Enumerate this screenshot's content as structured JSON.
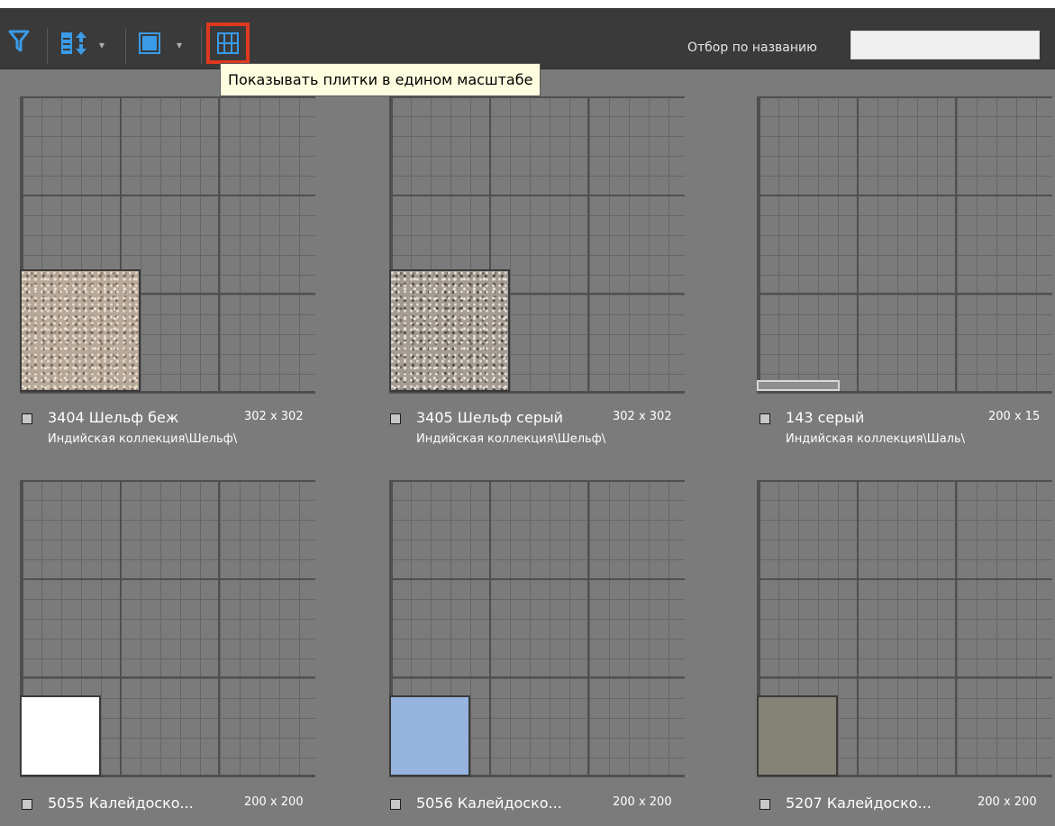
{
  "toolbar": {
    "icons": [
      "filter-icon",
      "sort-icon",
      "chevron-down-icon",
      "view-mode-icon",
      "chevron-down-icon",
      "uniform-scale-icon"
    ],
    "dropdown_glyph": "▾",
    "search": {
      "label": "Отбор по названию",
      "value": "",
      "placeholder": ""
    },
    "tooltip": "Показывать плитки в едином масштабе",
    "highlight_color": "#e0381f",
    "icon_color": "#3a9be8"
  },
  "tiles": [
    {
      "name": "3404 Шельф беж",
      "size": "302 x 302",
      "path": "Индийская коллекция\\Шельф\\",
      "color": "#b8a897",
      "texture": "speckle-beige"
    },
    {
      "name": "3405 Шельф серый",
      "size": "302 x 302",
      "path": "Индийская коллекция\\Шельф\\",
      "color": "#a49b92",
      "texture": "speckle-grey"
    },
    {
      "name": "143 серый",
      "size": "200 x 15",
      "path": "Индийская коллекция\\Шаль\\",
      "color": "#8e8e8e",
      "texture": ""
    },
    {
      "name": "5055 Калейдоско...",
      "size": "200 x 200",
      "path": "",
      "color": "#ffffff",
      "texture": ""
    },
    {
      "name": "5056 Калейдоско...",
      "size": "200 x 200",
      "path": "",
      "color": "#96b4de",
      "texture": ""
    },
    {
      "name": "5207 Калейдоско...",
      "size": "200 x 200",
      "path": "",
      "color": "#858276",
      "texture": ""
    }
  ]
}
